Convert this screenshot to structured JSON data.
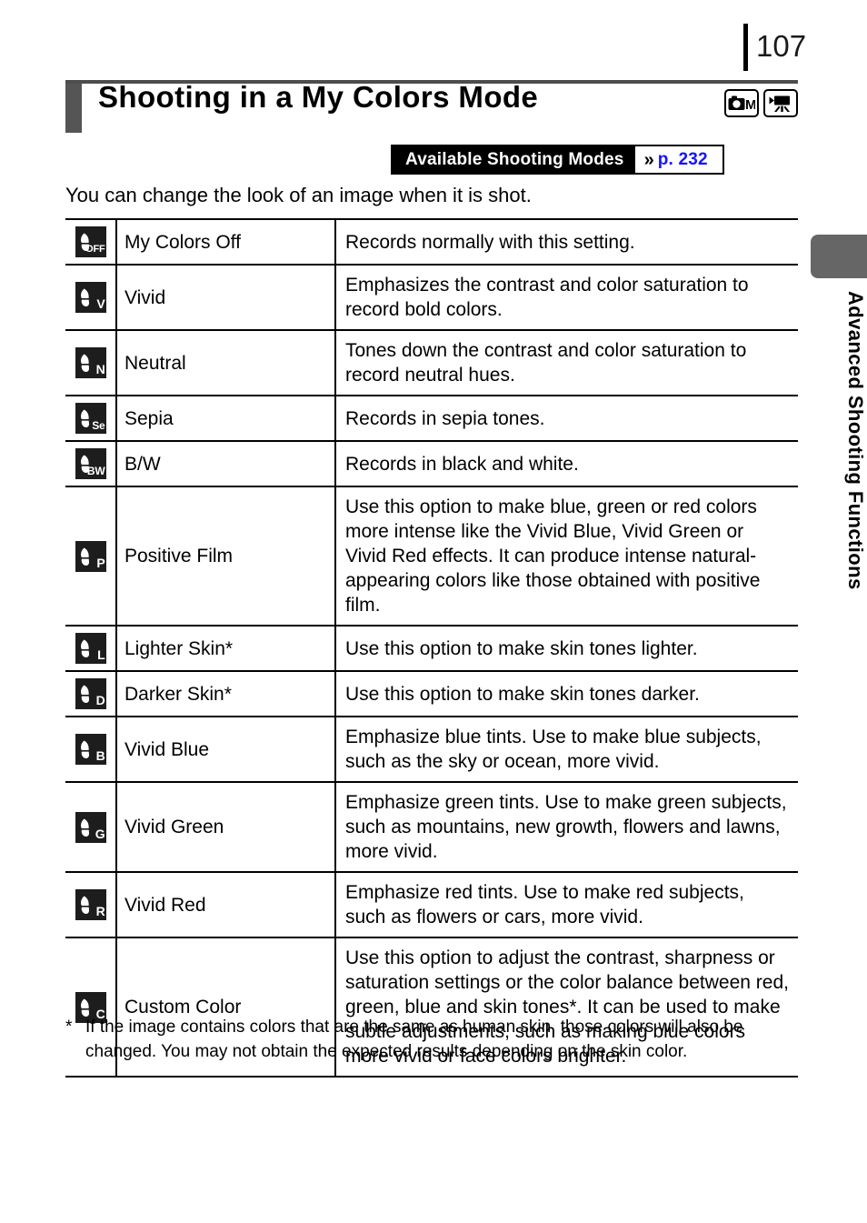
{
  "page": {
    "number": "107",
    "title": "Shooting in a My Colors Mode",
    "intro": "You can change the look of an image when it is shot."
  },
  "mode_icons": [
    {
      "name": "camera-manual-mode-icon",
      "label": "M"
    },
    {
      "name": "movie-mode-icon",
      "label": ""
    }
  ],
  "modes_banner": {
    "label": "Available Shooting Modes",
    "chevron": "»",
    "page_ref": "p. 232"
  },
  "table": {
    "rows": [
      {
        "icon_label": "OFF",
        "icon_name": "my-colors-off-icon",
        "name": "My Colors Off",
        "description": "Records normally with this setting."
      },
      {
        "icon_label": "V",
        "icon_name": "my-colors-vivid-icon",
        "name": "Vivid",
        "description": "Emphasizes the contrast and color saturation to record bold colors."
      },
      {
        "icon_label": "N",
        "icon_name": "my-colors-neutral-icon",
        "name": "Neutral",
        "description": "Tones down the contrast and color saturation to record neutral hues."
      },
      {
        "icon_label": "Se",
        "icon_name": "my-colors-sepia-icon",
        "name": "Sepia",
        "description": "Records in sepia tones."
      },
      {
        "icon_label": "BW",
        "icon_name": "my-colors-bw-icon",
        "name": "B/W",
        "description": "Records in black and white."
      },
      {
        "icon_label": "P",
        "icon_name": "my-colors-positive-film-icon",
        "name": "Positive Film",
        "description": "Use this option to make blue, green or red colors more intense like the Vivid Blue, Vivid Green or Vivid Red effects. It can produce intense natural-appearing colors like those obtained with positive film."
      },
      {
        "icon_label": "L",
        "icon_name": "my-colors-lighter-skin-icon",
        "name": "Lighter Skin*",
        "description": "Use this option to make skin tones lighter."
      },
      {
        "icon_label": "D",
        "icon_name": "my-colors-darker-skin-icon",
        "name": "Darker Skin*",
        "description": "Use this option to make skin tones darker."
      },
      {
        "icon_label": "B",
        "icon_name": "my-colors-vivid-blue-icon",
        "name": "Vivid Blue",
        "description": "Emphasize blue tints. Use to make blue subjects, such as the sky or ocean, more vivid."
      },
      {
        "icon_label": "G",
        "icon_name": "my-colors-vivid-green-icon",
        "name": "Vivid Green",
        "description": "Emphasize green tints. Use to make green subjects, such as mountains, new growth, flowers and lawns, more vivid."
      },
      {
        "icon_label": "R",
        "icon_name": "my-colors-vivid-red-icon",
        "name": "Vivid Red",
        "description": "Emphasize red tints. Use to make red subjects, such as flowers or cars, more vivid."
      },
      {
        "icon_label": "C",
        "icon_name": "my-colors-custom-color-icon",
        "name": "Custom Color",
        "description": "Use this option to adjust the contrast, sharpness or saturation settings or the color balance between red, green, blue and skin tones*. It can be used to make subtle adjustments, such as making blue colors more vivid or face colors brighter."
      }
    ]
  },
  "footnote": {
    "marker": "*",
    "text": "If the image contains colors that are the same as human skin, those colors will also be changed. You may not obtain the expected results depending on the skin color."
  },
  "side_tab": {
    "label": "Advanced Shooting Functions"
  },
  "colors": {
    "page_ref_blue": "#1414ff",
    "title_accent_gray": "#555555",
    "side_tab_gray": "#666666",
    "icon_background": "#1d1d1d"
  }
}
